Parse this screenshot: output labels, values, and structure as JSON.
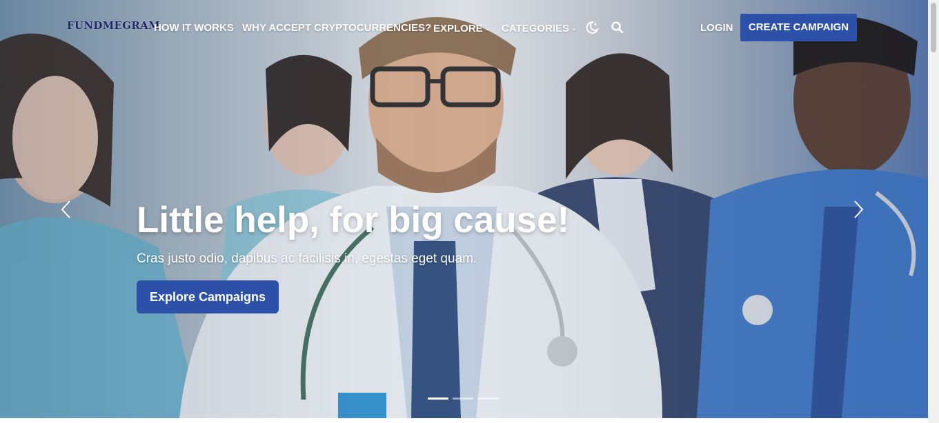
{
  "brand": {
    "logo_text": "FUNDMEGRAM"
  },
  "nav": {
    "how_it_works": "HOW IT WORKS",
    "why_crypto": "WHY ACCEPT CRYPTOCURRENCIES?",
    "explore": "EXPLORE",
    "categories": "CATEGORIES",
    "login": "LOGIN",
    "create_campaign": "CREATE CAMPAIGN",
    "icons": [
      "dark-mode-moon-icon",
      "search-icon"
    ]
  },
  "hero": {
    "title": "Little help, for big cause!",
    "subtitle": "Cras justo odio, dapibus ac facilisis in, egestas eget quam.",
    "cta": "Explore Campaigns",
    "slides_total": 3,
    "active_slide": 1
  },
  "colors": {
    "accent": "#2d51a8",
    "logo": "#1c2366",
    "text_on_hero": "#ffffff"
  }
}
